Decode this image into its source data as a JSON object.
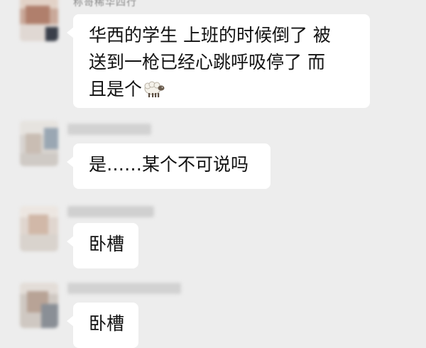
{
  "messages": [
    {
      "sender_nickname": "称哥稀华四行",
      "lines": [
        "华西的学生 上班的时候倒了 被",
        "送到一枪已经心跳呼吸停了 而",
        "且是个"
      ],
      "trailing_icon": "sheep-emoji"
    },
    {
      "lines": [
        "是……某个不可说吗"
      ]
    },
    {
      "lines": [
        "卧槽"
      ]
    },
    {
      "lines": [
        "卧槽"
      ]
    }
  ],
  "colors": {
    "chat_background": "#ededed",
    "bubble_background": "#ffffff",
    "text": "#111111"
  }
}
